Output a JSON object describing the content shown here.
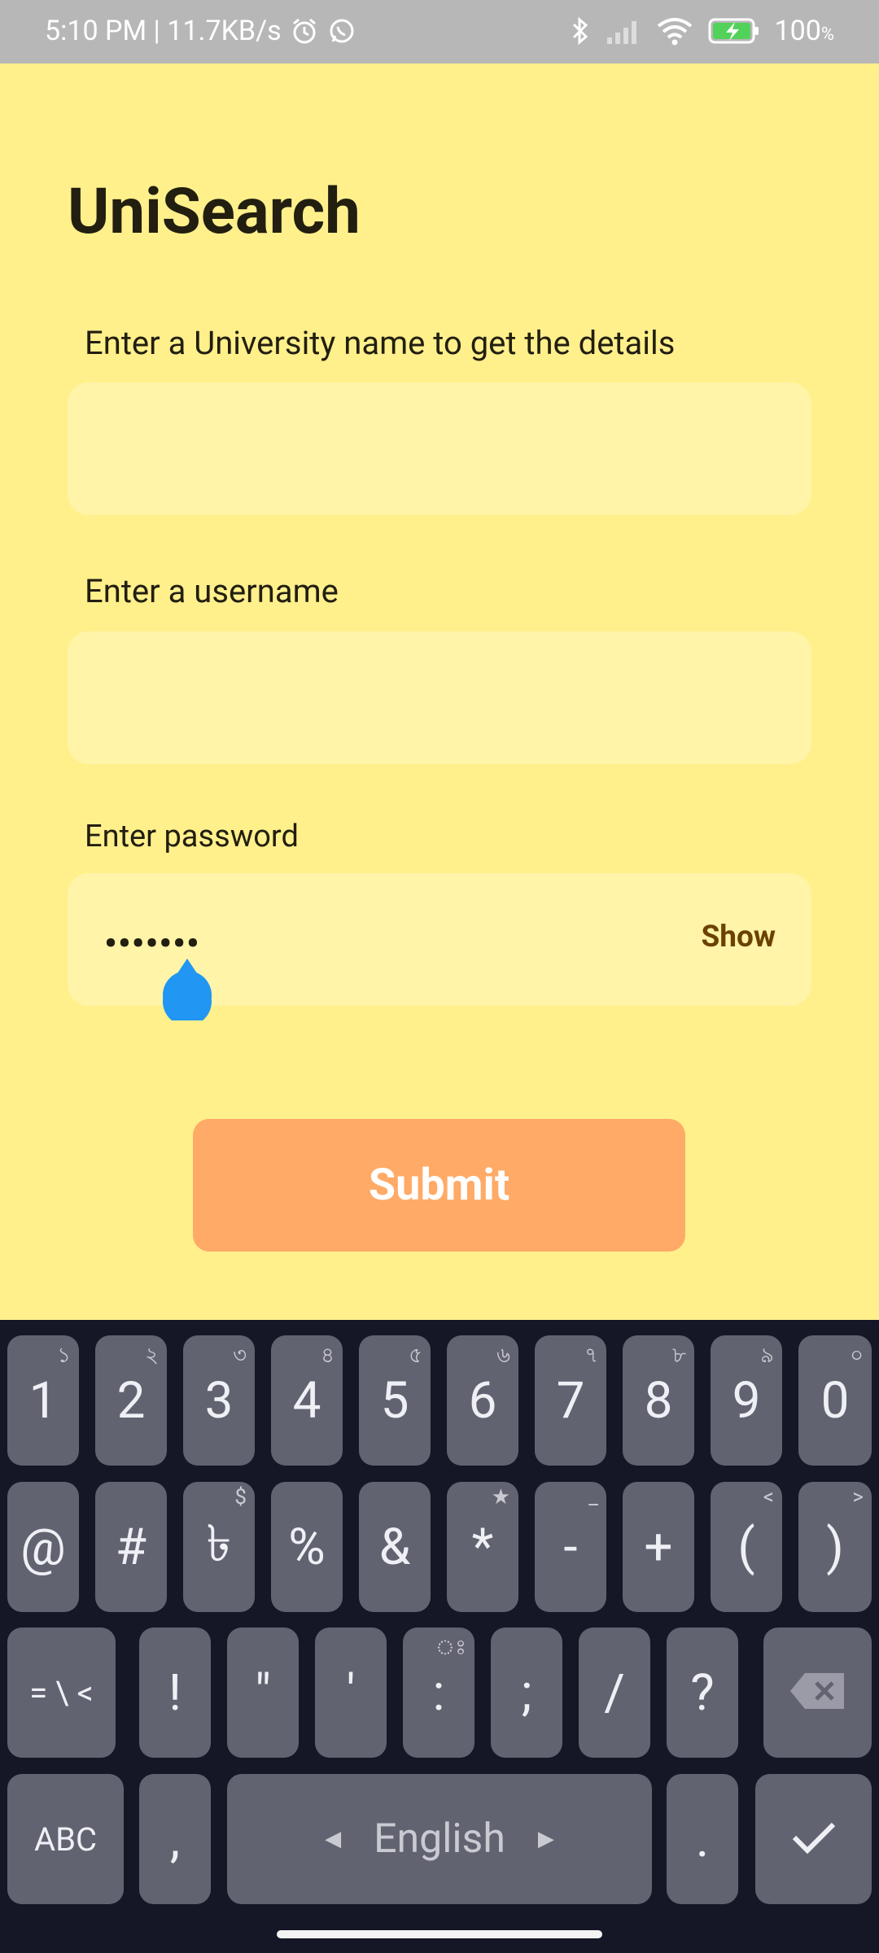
{
  "status_bar": {
    "time_speed": "5:10 PM | 11.7KB/s",
    "battery": "100",
    "battery_unit": "%"
  },
  "app": {
    "title": "UniSearch",
    "university_label": "Enter a University name to get the details",
    "university_value": "",
    "username_label": "Enter a username",
    "username_value": "",
    "password_label": "Enter password",
    "password_value": "•••••••",
    "show_label": "Show",
    "submit_label": "Submit"
  },
  "keyboard": {
    "row1": [
      {
        "main": "1",
        "hint": "১"
      },
      {
        "main": "2",
        "hint": "২"
      },
      {
        "main": "3",
        "hint": "৩"
      },
      {
        "main": "4",
        "hint": "৪"
      },
      {
        "main": "5",
        "hint": "৫"
      },
      {
        "main": "6",
        "hint": "৬"
      },
      {
        "main": "7",
        "hint": "৭"
      },
      {
        "main": "8",
        "hint": "৮"
      },
      {
        "main": "9",
        "hint": "৯"
      },
      {
        "main": "0",
        "hint": "০"
      }
    ],
    "row2": [
      {
        "main": "@",
        "hint": ""
      },
      {
        "main": "#",
        "hint": ""
      },
      {
        "main": "৳",
        "hint": "$"
      },
      {
        "main": "%",
        "hint": ""
      },
      {
        "main": "&",
        "hint": ""
      },
      {
        "main": "*",
        "hint": "★"
      },
      {
        "main": "-",
        "hint": "_"
      },
      {
        "main": "+",
        "hint": ""
      },
      {
        "main": "(",
        "hint": "<"
      },
      {
        "main": ")",
        "hint": ">"
      }
    ],
    "row3": {
      "symbols_key": "= \\ <",
      "keys": [
        {
          "main": "!",
          "hint": ""
        },
        {
          "main": "\"",
          "hint": ""
        },
        {
          "main": "'",
          "hint": ""
        },
        {
          "main": ":",
          "hint": "ঃ"
        },
        {
          "main": ";",
          "hint": ""
        },
        {
          "main": "/",
          "hint": ""
        },
        {
          "main": "?",
          "hint": ""
        }
      ]
    },
    "row4": {
      "abc_key": "ABC",
      "comma_key": ",",
      "space_label": "English",
      "period_key": "."
    }
  },
  "colors": {
    "background": "#fff08c",
    "input_bg": "#fff4a8",
    "submit_bg": "#ffaa66",
    "keyboard_bg": "#151727",
    "key_bg": "#626370",
    "cursor_handle": "#2196f3"
  }
}
